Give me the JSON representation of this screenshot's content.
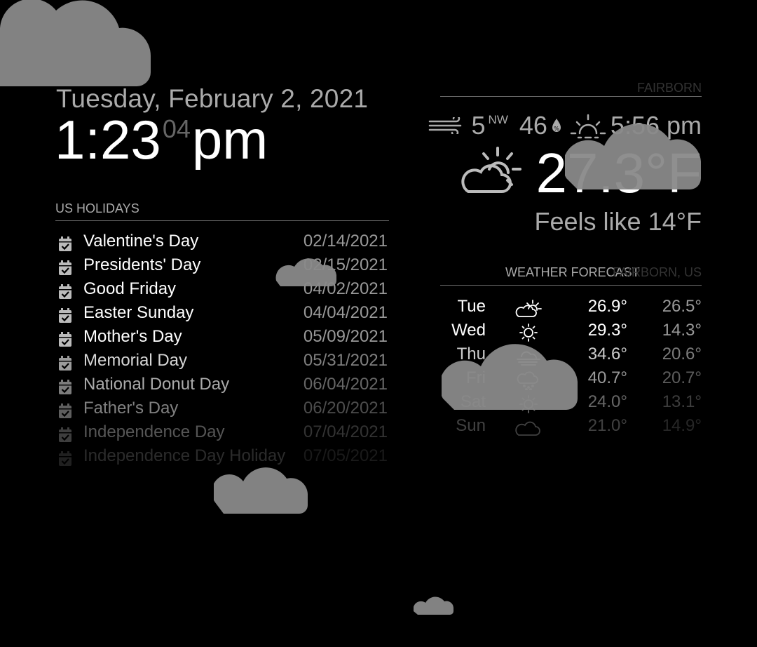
{
  "clock": {
    "date": "Tuesday, February 2, 2021",
    "hours_minutes": "1:23",
    "seconds": "04",
    "period": "pm"
  },
  "holidays": {
    "header": "US HOLIDAYS",
    "icon": "calendar-check-icon",
    "items": [
      {
        "title": "Valentine's Day",
        "date": "02/14/2021"
      },
      {
        "title": "Presidents' Day",
        "date": "02/15/2021"
      },
      {
        "title": "Good Friday",
        "date": "04/02/2021"
      },
      {
        "title": "Easter Sunday",
        "date": "04/04/2021"
      },
      {
        "title": "Mother's Day",
        "date": "05/09/2021"
      },
      {
        "title": "Memorial Day",
        "date": "05/31/2021"
      },
      {
        "title": "National Donut Day",
        "date": "06/04/2021"
      },
      {
        "title": "Father's Day",
        "date": "06/20/2021"
      },
      {
        "title": "Independence Day",
        "date": "07/04/2021"
      },
      {
        "title": "Independence Day Holiday",
        "date": "07/05/2021"
      }
    ]
  },
  "current_weather": {
    "location": "FAIRBORN",
    "wind_speed": "5",
    "wind_direction": "NW",
    "humidity": "46",
    "sunset": "5:56 pm",
    "temperature": "27.3°F",
    "feels_like": "Feels like 14°F",
    "icon": "partly-cloudy-day-icon"
  },
  "forecast": {
    "header": "WEATHER FORECAST",
    "location": "FAIRBORN, US",
    "days": [
      {
        "day": "Tue",
        "icon": "partly-cloudy-icon",
        "max": "26.9°",
        "min": "26.5°"
      },
      {
        "day": "Wed",
        "icon": "sunny-icon",
        "max": "29.3°",
        "min": "14.3°"
      },
      {
        "day": "Thu",
        "icon": "fog-icon",
        "max": "34.6°",
        "min": "20.6°"
      },
      {
        "day": "Fri",
        "icon": "snow-icon",
        "max": "40.7°",
        "min": "20.7°"
      },
      {
        "day": "Sat",
        "icon": "sunny-icon",
        "max": "24.0°",
        "min": "13.1°"
      },
      {
        "day": "Sun",
        "icon": "cloudy-icon",
        "max": "21.0°",
        "min": "14.9°"
      }
    ]
  },
  "colors": {
    "background": "#000000",
    "text_primary": "#ffffff",
    "text_dim": "#aaaaaa",
    "cloud": "#8a8a8a"
  }
}
